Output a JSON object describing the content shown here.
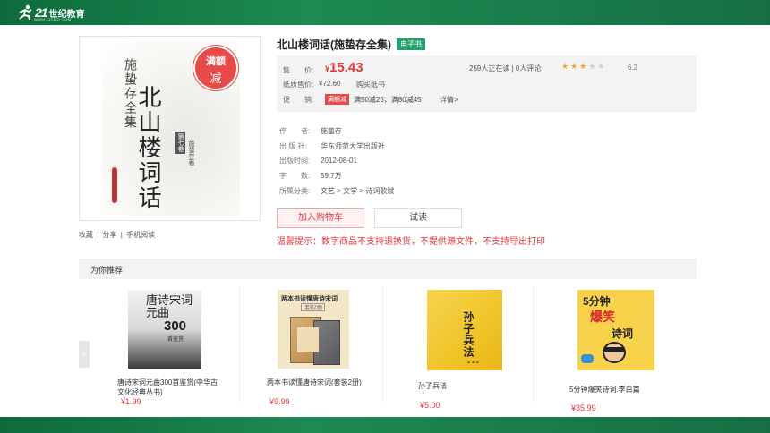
{
  "header": {
    "logo_num": "21",
    "logo_text": "世纪教育",
    "logo_sub": "WWW.21CNJY.COM"
  },
  "cover": {
    "small_title": "施蛰存全集",
    "big_title": "北山楼词话",
    "volume": "第七卷",
    "author": "施蛰存著",
    "promo_line1": "满额",
    "promo_line2": "减"
  },
  "share": {
    "collect": "收藏",
    "sep1": "|",
    "share": "分享",
    "sep2": "|",
    "mobile": "手机阅读"
  },
  "book": {
    "title": "北山楼词话(施蛰存全集)",
    "tag": "电子书"
  },
  "price": {
    "label": "售　　价:",
    "currency": "¥",
    "value": "15.43",
    "paper_label": "纸质售价:",
    "paper_value": "¥72.60",
    "buy_paper": "购买纸书",
    "promo_label": "促　　销:",
    "promo_tag": "满额减",
    "promo_text": "满50减25，满80减45",
    "detail": "详情>",
    "readers": "259人正在读 | 0人评论",
    "rating": "6.2",
    "stars_on": "★★★",
    "stars_off": "★★"
  },
  "meta": [
    {
      "key": "作　　者:",
      "value": "施蛰存"
    },
    {
      "key": "出 版 社:",
      "value": "华东师范大学出版社"
    },
    {
      "key": "出版时间:",
      "value": "2012-08-01"
    },
    {
      "key": "字　　数:",
      "value": "59.7万"
    },
    {
      "key": "所属分类:",
      "value": "文艺 > 文学 > 诗词歌赋"
    }
  ],
  "actions": {
    "cart": "加入购物车",
    "trial": "试读"
  },
  "notice": "温馨提示：数字商品不支持退换货，不提供源文件，不支持导出打印",
  "recommend": {
    "title": "为你推荐",
    "prev": "‹",
    "items": [
      {
        "name": "唐诗宋词元曲300首鉴赏(中华古文化经典丛书)",
        "price": "¥1.99",
        "cover_title": "唐诗宋词元曲",
        "cover_num": "300",
        "cover_sub": "首鉴赏"
      },
      {
        "name": "两本书读懂唐诗宋词(套装2册)",
        "price": "¥9.99",
        "cover_title": "两本书读懂唐诗宋词",
        "cover_sub": "(套装2册)"
      },
      {
        "name": "孙子兵法",
        "price": "¥5.00",
        "cover_title": "孙子兵法"
      },
      {
        "name": "5分钟爆笑诗词.李白篇",
        "price": "¥35.99",
        "cover_t1": "5分钟",
        "cover_t2": "爆笑",
        "cover_t3": "诗词"
      }
    ]
  },
  "colors": {
    "brand_green": "#1d8a52",
    "accent_red": "#e23a3a",
    "tag_green": "#22a36e"
  }
}
